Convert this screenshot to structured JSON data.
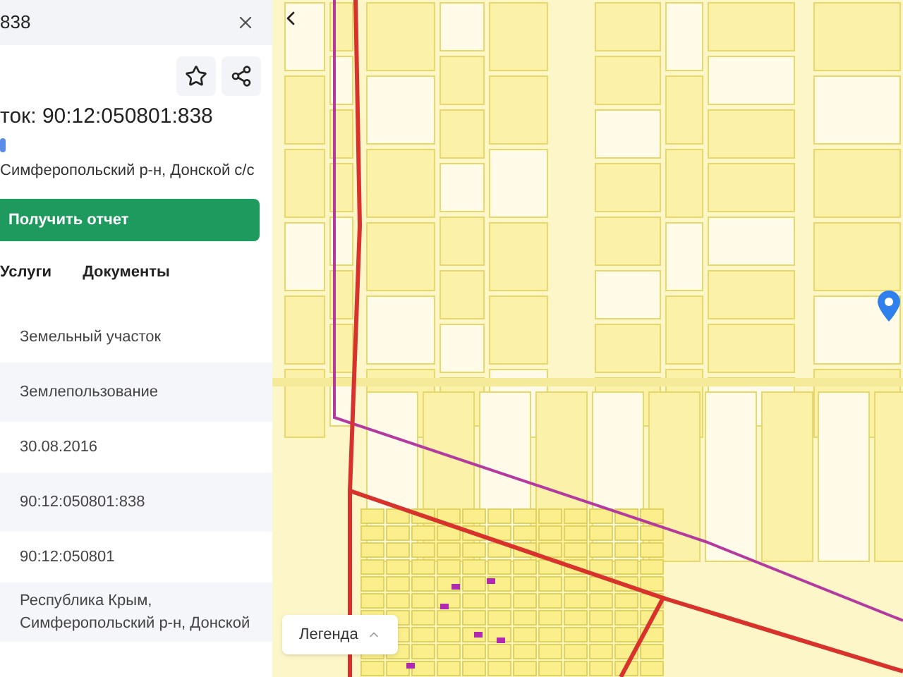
{
  "search": {
    "value": "838"
  },
  "title": "ток: 90:12:050801:838",
  "address": "Симферопольский р-н, Донской с/с",
  "report_button": "Получить отчет",
  "tabs": [
    {
      "label": "Услуги",
      "selected": false
    },
    {
      "label": "Документы",
      "selected": false
    }
  ],
  "rows": [
    "Земельный участок",
    "Землепользование",
    "30.08.2016",
    "90:12:050801:838",
    "90:12:050801",
    "Республика Крым, Симферопольский р-н, Донской"
  ],
  "legend_button": "Легенда"
}
